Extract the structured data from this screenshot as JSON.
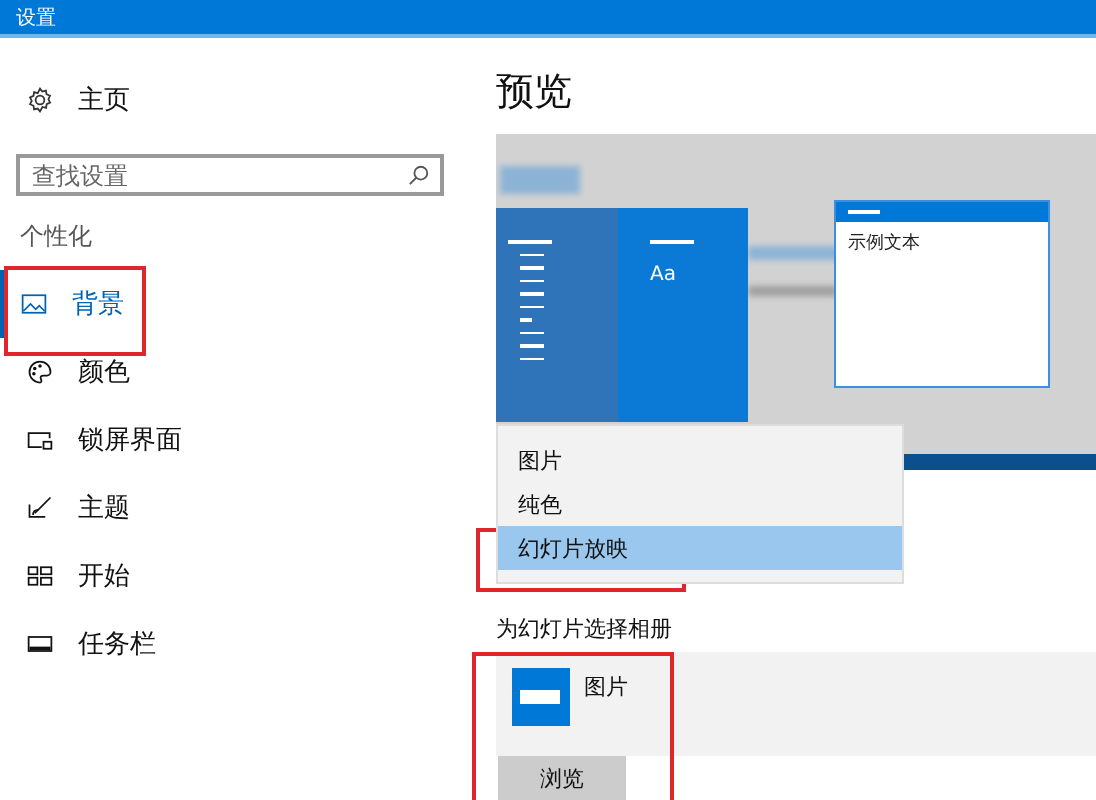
{
  "window": {
    "title": "设置"
  },
  "sidebar": {
    "home": "主页",
    "search": {
      "placeholder": "查找设置"
    },
    "section": "个性化",
    "items": [
      {
        "label": "背景",
        "kind": "picture",
        "selected": true,
        "highlighted": true
      },
      {
        "label": "颜色",
        "kind": "palette",
        "selected": false,
        "highlighted": false
      },
      {
        "label": "锁屏界面",
        "kind": "lock",
        "selected": false,
        "highlighted": false
      },
      {
        "label": "主题",
        "kind": "brush",
        "selected": false,
        "highlighted": false
      },
      {
        "label": "开始",
        "kind": "start",
        "selected": false,
        "highlighted": false
      },
      {
        "label": "任务栏",
        "kind": "taskbar",
        "selected": false,
        "highlighted": false
      }
    ]
  },
  "main": {
    "heading": "预览",
    "preview": {
      "tile_text": "Aa",
      "window_text": "示例文本"
    },
    "dropdown": [
      {
        "label": "图片",
        "selected": false,
        "highlighted": false
      },
      {
        "label": "纯色",
        "selected": false,
        "highlighted": false
      },
      {
        "label": "幻灯片放映",
        "selected": true,
        "highlighted": true
      }
    ],
    "album_label": "为幻灯片选择相册",
    "album": {
      "name": "图片",
      "highlighted": true
    },
    "browse_button": "浏览"
  }
}
